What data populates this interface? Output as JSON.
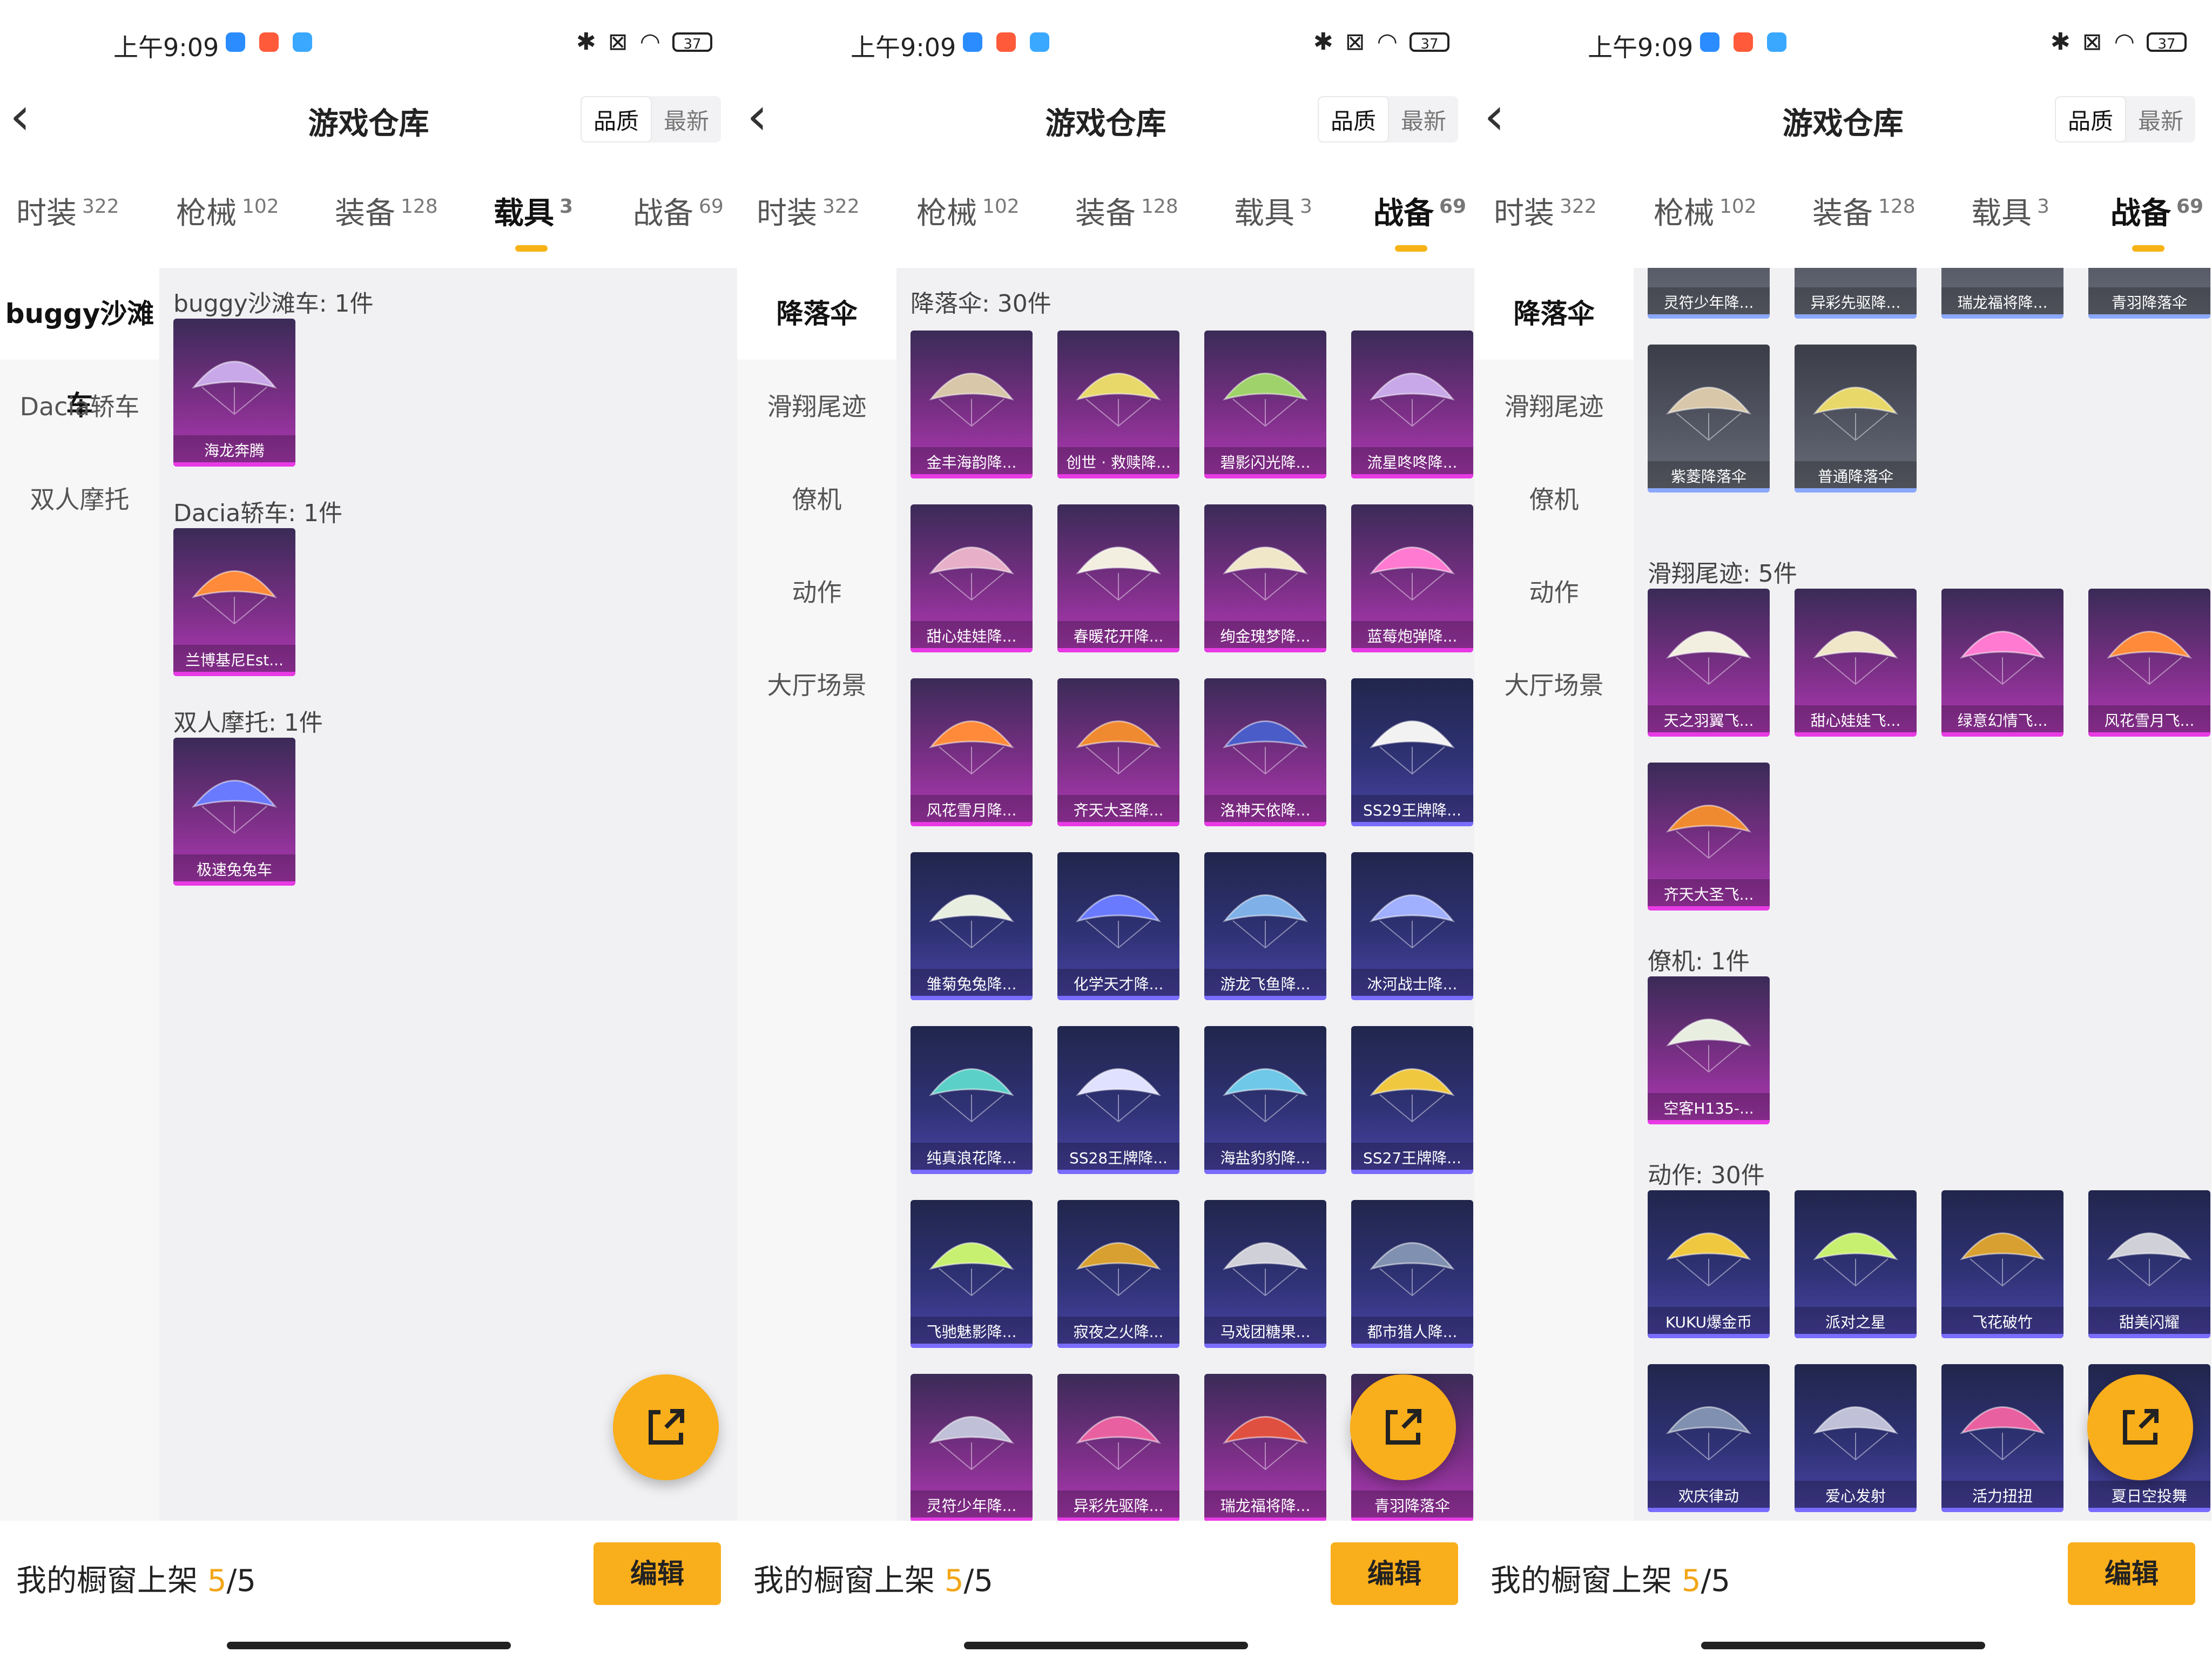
{
  "status": {
    "time": "上午9:09",
    "battery": "37"
  },
  "header": {
    "title": "游戏仓库",
    "sort_quality": "品质",
    "sort_newest": "最新"
  },
  "tabs": [
    {
      "label": "时装",
      "count": "322"
    },
    {
      "label": "枪械",
      "count": "102"
    },
    {
      "label": "装备",
      "count": "128"
    },
    {
      "label": "载具",
      "count": "3"
    },
    {
      "label": "战备",
      "count": "69"
    }
  ],
  "panel1": {
    "nav": [
      "buggy沙滩车",
      "Dacia轿车",
      "双人摩托"
    ],
    "sections": [
      {
        "title": "buggy沙滩车: 1件",
        "items": [
          "海龙奔腾"
        ]
      },
      {
        "title": "Dacia轿车: 1件",
        "items": [
          "兰博基尼Est..."
        ]
      },
      {
        "title": "双人摩托: 1件",
        "items": [
          "极速兔兔车"
        ]
      }
    ]
  },
  "panel2": {
    "nav": [
      "降落伞",
      "滑翔尾迹",
      "僚机",
      "动作",
      "大厅场景"
    ],
    "section_title": "降落伞: 30件",
    "items": [
      "金丰海韵降...",
      "创世 · 救赎降...",
      "碧影闪光降...",
      "流星咚咚降...",
      "甜心娃娃降...",
      "春暖花开降...",
      "绚金瑰梦降...",
      "蓝莓炮弹降...",
      "风花雪月降...",
      "齐天大圣降...",
      "洛神天依降...",
      "SS29王牌降...",
      "雏菊兔兔降...",
      "化学天才降...",
      "游龙飞鱼降...",
      "冰河战士降...",
      "纯真浪花降...",
      "SS28王牌降...",
      "海盐豹豹降...",
      "SS27王牌降...",
      "飞驰魅影降...",
      "寂夜之火降...",
      "马戏团糖果...",
      "都市猎人降...",
      "灵符少年降...",
      "异彩先驱降...",
      "瑞龙福将降...",
      "青羽降落伞"
    ]
  },
  "panel3": {
    "nav": [
      "降落伞",
      "滑翔尾迹",
      "僚机",
      "动作",
      "大厅场景"
    ],
    "top_items": [
      "灵符少年降...",
      "异彩先驱降...",
      "瑞龙福将降...",
      "青羽降落伞",
      "紫菱降落伞",
      "普通降落伞"
    ],
    "sections": [
      {
        "title": "滑翔尾迹: 5件",
        "items": [
          "天之羽翼飞...",
          "甜心娃娃飞...",
          "绿意幻情飞...",
          "风花雪月飞...",
          "齐天大圣飞..."
        ]
      },
      {
        "title": "僚机: 1件",
        "items": [
          "空客H135-..."
        ]
      },
      {
        "title": "动作: 30件",
        "items": [
          "KUKU爆金币",
          "派对之星",
          "飞花破竹",
          "甜美闪耀",
          "欢庆律动",
          "爱心发射",
          "活力扭扭",
          "夏日空投舞"
        ]
      }
    ]
  },
  "bottom": {
    "label": "我的橱窗上架",
    "count": "5",
    "total": "/5",
    "edit": "编辑"
  }
}
